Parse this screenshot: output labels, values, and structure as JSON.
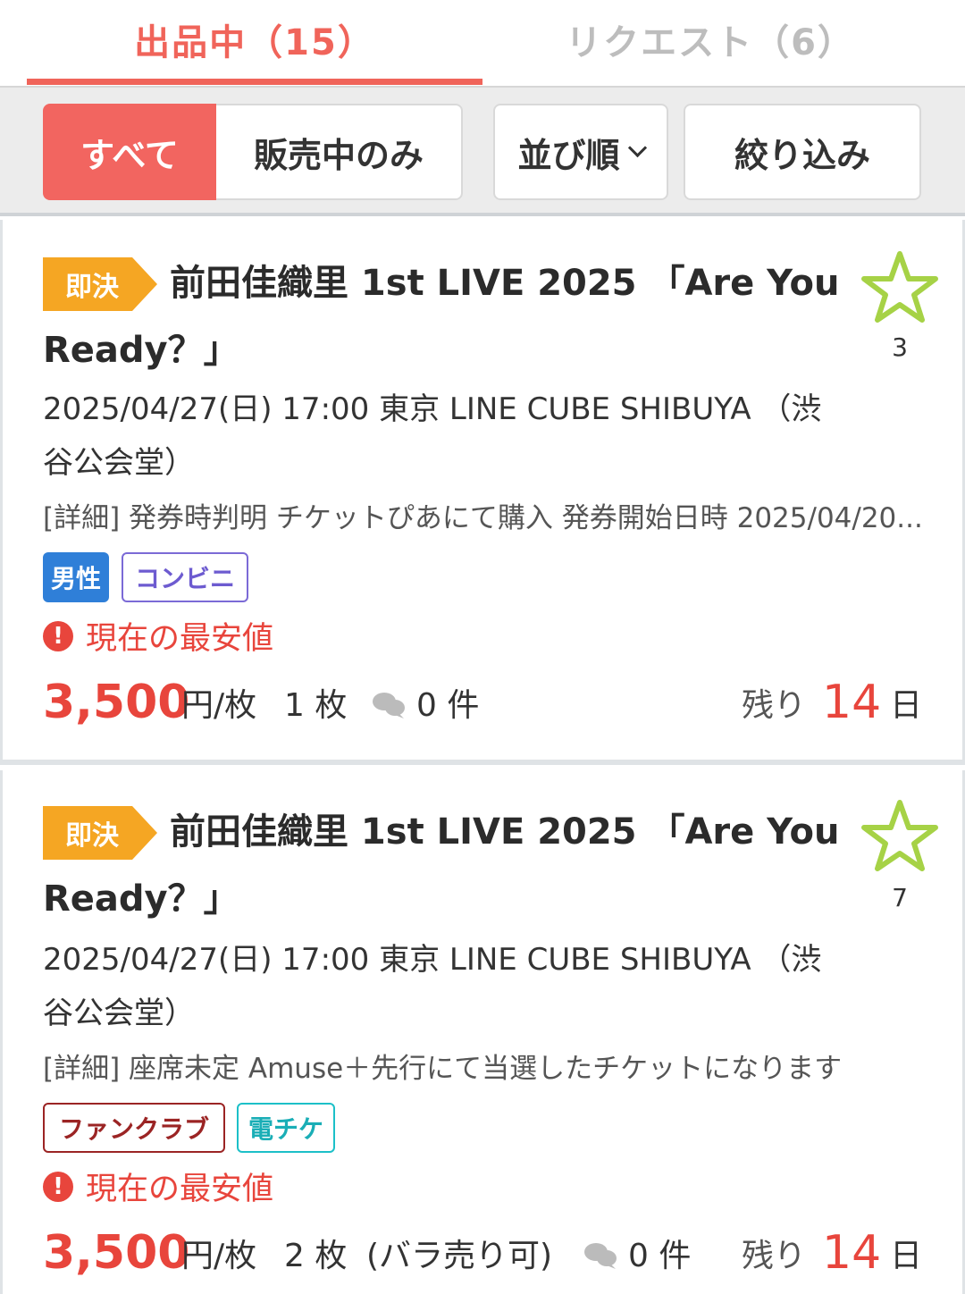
{
  "tabs": {
    "selling": "出品中（15）",
    "request": "リクエスト（6）"
  },
  "toolbar": {
    "all": "すべて",
    "on_sale_only": "販売中のみ",
    "sort": "並び順",
    "filter": "絞り込み"
  },
  "colors": {
    "accent": "#f26560",
    "price": "#e8453c",
    "badge": "#f5a623",
    "star": "#a6d246"
  },
  "listings": [
    {
      "badge": "即決",
      "title": "前田佳織里 1st LIVE 2025 「Are You Ready？」",
      "favorites": "3",
      "event": "2025/04/27(日) 17:00 東京 LINE CUBE SHIBUYA （渋谷公会堂）",
      "detail": "[詳細] 発券時判明 チケットぴあにて購入 発券開始日時 2025/04/20...",
      "tags": [
        {
          "label": "男性",
          "icon": "male-tag"
        },
        {
          "label": "コンビニ",
          "icon": "convenience-store-tag"
        }
      ],
      "lowest_label": "現在の最安値",
      "price": "3,500",
      "price_unit": "円/枚",
      "quantity": "1 枚",
      "note": "",
      "comments": "0 件",
      "remaining_label": "残り",
      "remaining_days": "14",
      "days_unit": "日"
    },
    {
      "badge": "即決",
      "title": "前田佳織里 1st LIVE 2025 「Are You Ready？」",
      "favorites": "7",
      "event": "2025/04/27(日) 17:00 東京 LINE CUBE SHIBUYA （渋谷公会堂）",
      "detail": "[詳細] 座席未定 Amuse＋先行にて当選したチケットになります",
      "tags": [
        {
          "label": "ファンクラブ",
          "icon": "fanclub-tag"
        },
        {
          "label": "電チケ",
          "icon": "e-ticket-tag"
        }
      ],
      "lowest_label": "現在の最安値",
      "price": "3,500",
      "price_unit": "円/枚",
      "quantity": "2 枚",
      "note": "(バラ売り可)",
      "comments": "0 件",
      "remaining_label": "残り",
      "remaining_days": "14",
      "days_unit": "日"
    }
  ]
}
